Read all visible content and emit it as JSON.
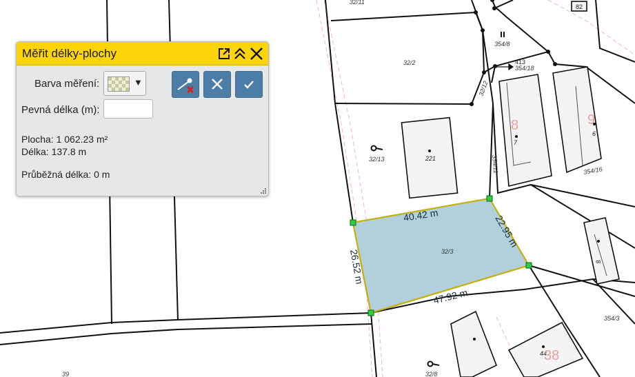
{
  "panel": {
    "title": "Měřit délky-plochy",
    "color_label": "Barva měření:",
    "fixed_length_label": "Pevná délka (m):",
    "fixed_length_value": "",
    "area_text": "Plocha: 1 062.23 m²",
    "length_text": "Délka: 137.8 m",
    "running_length_text": "Průběžná délka: 0 m",
    "icons": {
      "popout": "external-link-icon",
      "collapse": "double-chevron-up-icon",
      "close": "close-icon",
      "color_dropdown": "caret-down-icon",
      "clear_tool": "erase-measure-icon",
      "cancel": "x-icon",
      "confirm": "check-icon"
    }
  },
  "map": {
    "parcel_labels": {
      "p32_11": "32/11",
      "p32_2": "32/2",
      "p32_13": "32/13",
      "p32_12": "32/12",
      "p32_3": "32/3",
      "p32_8": "32/8",
      "p354_8": "354/8",
      "p354_18": "354/18",
      "p354_11": "354/11",
      "p354_16": "354/16",
      "p354_3": "354/3",
      "p39": "39"
    },
    "building_labels": {
      "b221": "221",
      "b7": "7",
      "b6": "6",
      "b8": "8",
      "b44": "44",
      "b82": "82"
    },
    "house_numbers": {
      "n8": "8",
      "n9": "9",
      "n38": "38"
    },
    "misc_labels": {
      "n413": "413"
    },
    "measurements": {
      "top": "40.42 m",
      "right": "22.95 m",
      "left": "26.52 m",
      "bottom": "47.92 m"
    },
    "colors": {
      "measure_fill": "#a8cbd8",
      "measure_stroke": "#c8b400",
      "vertex": "#2ecc40",
      "house_number": "#e8a0a0",
      "panel_header": "#fdd40a",
      "tool_button": "#4c7da6"
    }
  }
}
